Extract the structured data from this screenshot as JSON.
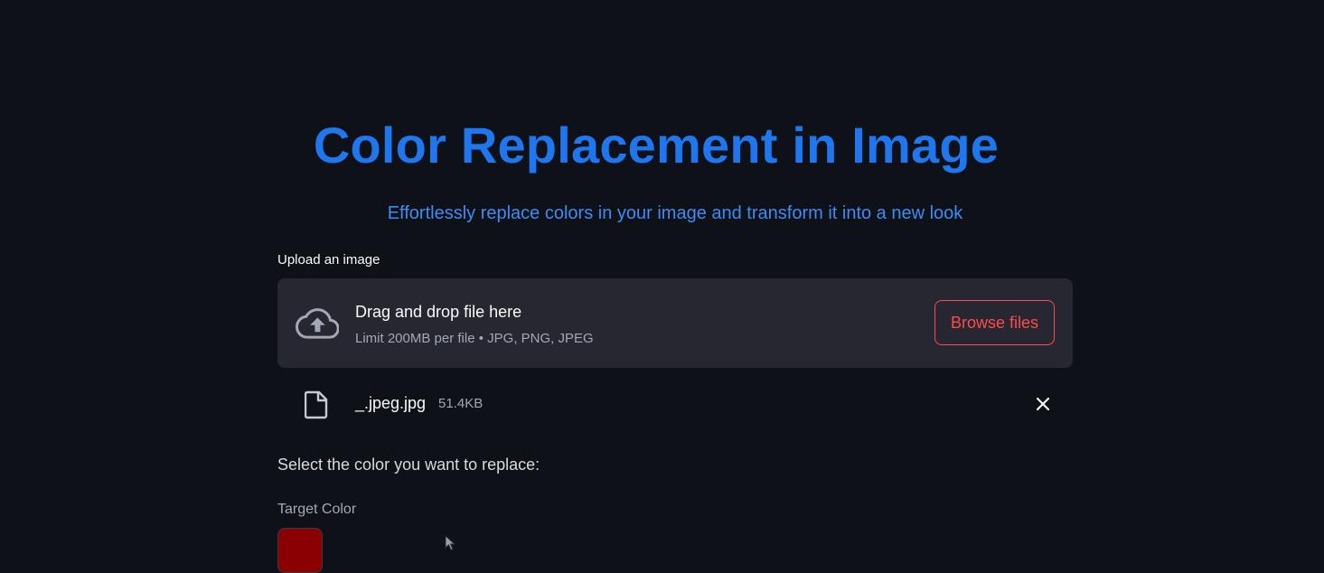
{
  "header": {
    "title": "Color Replacement in Image",
    "subtitle": "Effortlessly replace colors in your image and transform it into a new look"
  },
  "uploader": {
    "label": "Upload an image",
    "dropzone_title": "Drag and drop file here",
    "dropzone_limit": "Limit 200MB per file • JPG, PNG, JPEG",
    "browse_label": "Browse files",
    "icon": "cloud-upload-icon"
  },
  "uploaded_file": {
    "name": "_.jpeg.jpg",
    "size": "51.4KB",
    "icon": "file-icon",
    "remove_icon": "close-icon"
  },
  "color_section": {
    "prompt": "Select the color you want to replace:",
    "target_label": "Target Color",
    "target_color": "#8b0000"
  },
  "colors": {
    "background": "#0e1117",
    "title": "#1f77f0",
    "subtitle": "#3d8df5",
    "accent": "#ff4b4b",
    "panel": "#262730"
  }
}
